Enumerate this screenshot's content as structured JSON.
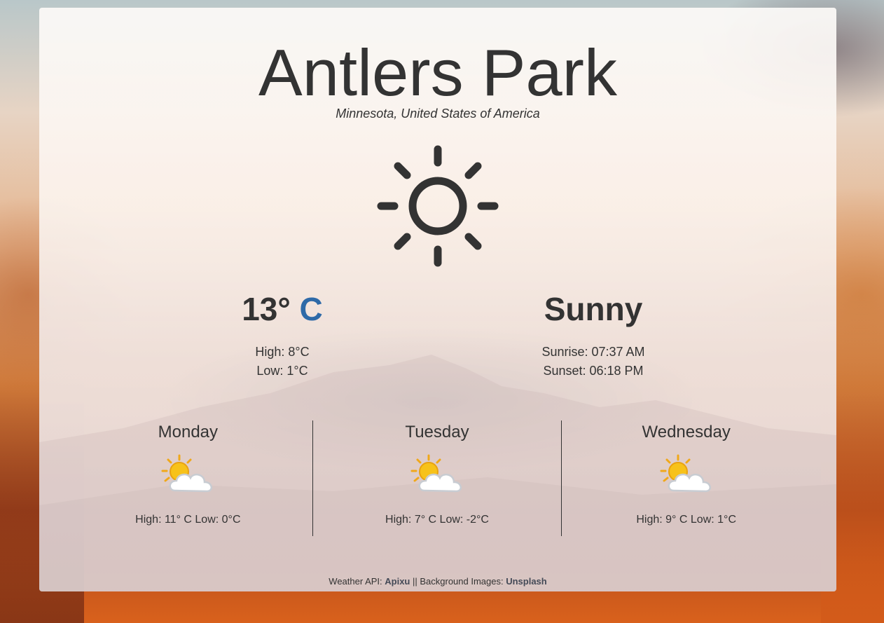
{
  "location": {
    "city": "Antlers Park",
    "region": "Minnesota, United States of America"
  },
  "current": {
    "icon": "sun-icon",
    "temperature": "13°",
    "unit": "C",
    "condition": "Sunny",
    "high": "High: 8°C",
    "low": "Low: 1°C",
    "sunrise": "Sunrise: 07:37 AM",
    "sunset": "Sunset: 06:18 PM"
  },
  "forecast": [
    {
      "day": "Monday",
      "icon": "partly-cloudy-icon",
      "range": "High: 11° C Low: 0°C"
    },
    {
      "day": "Tuesday",
      "icon": "partly-cloudy-icon",
      "range": "High: 7° C Low: -2°C"
    },
    {
      "day": "Wednesday",
      "icon": "partly-cloudy-icon",
      "range": "High: 9° C Low: 1°C"
    }
  ],
  "footer": {
    "api_label": "Weather API: ",
    "api_link": "Apixu",
    "separator": " || Background Images: ",
    "images_link": "Unsplash"
  },
  "colors": {
    "text": "#333333",
    "unit_accent": "#2e6aa8",
    "sun_yellow": "#f7c21a",
    "cloud_white": "#ffffff"
  }
}
